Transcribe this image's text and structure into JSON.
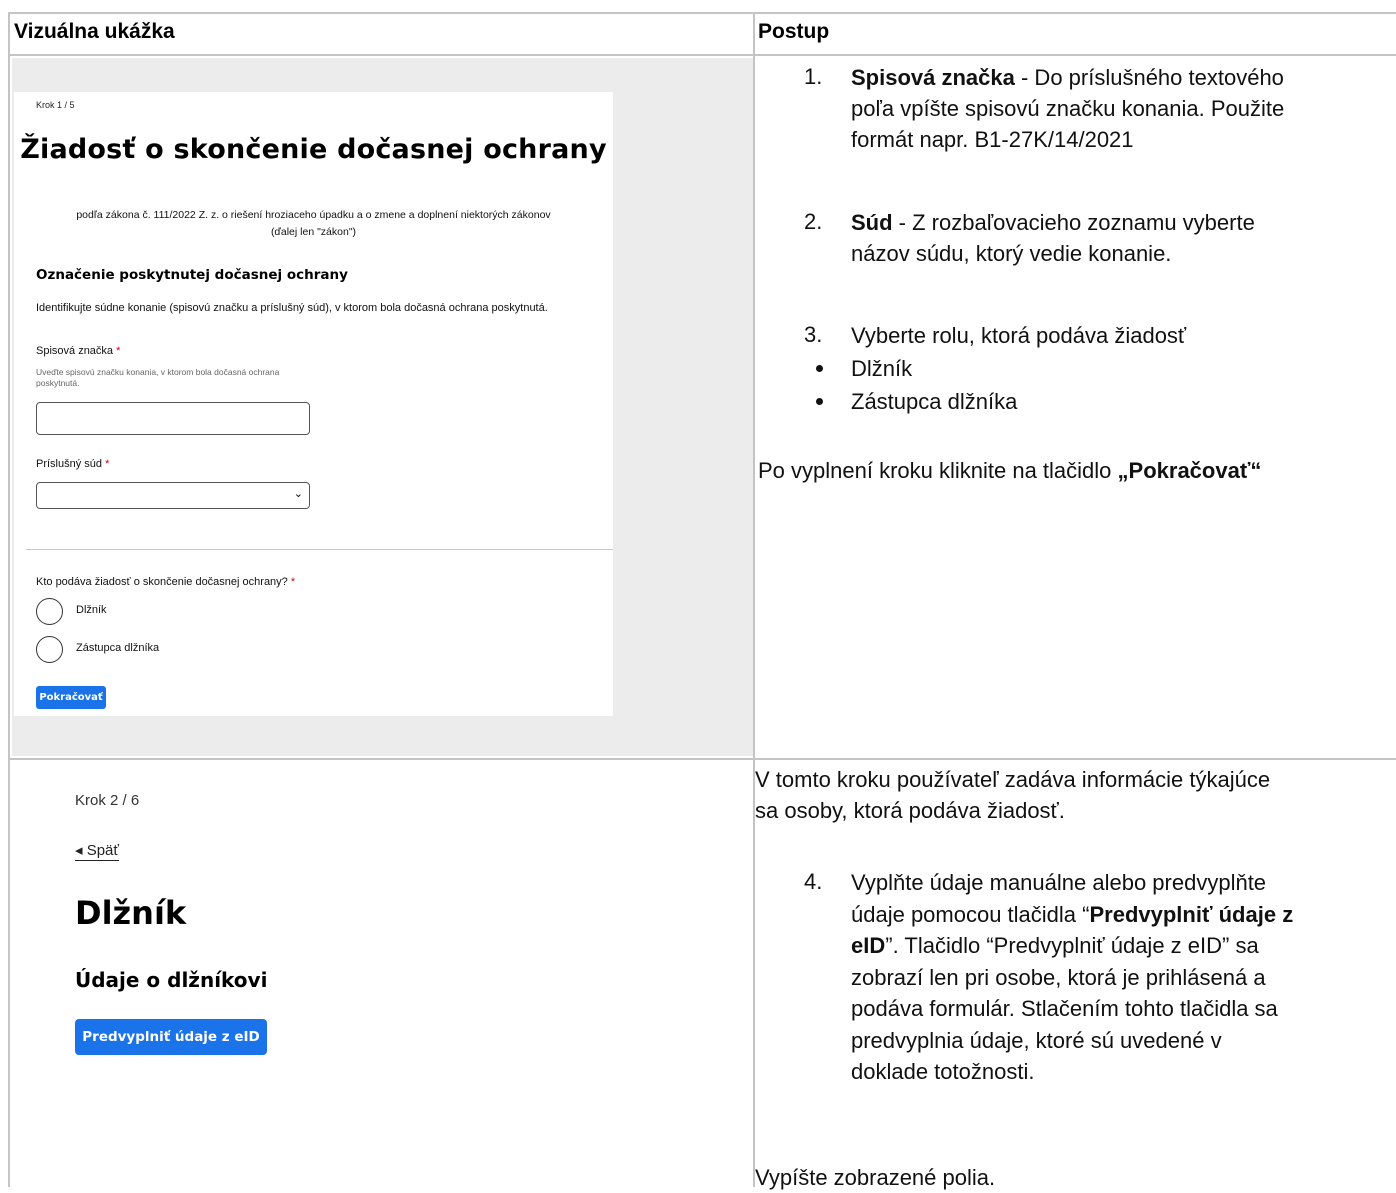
{
  "table": {
    "col1_header": "Vizuálna ukážka",
    "col2_header": "Postup"
  },
  "shot1": {
    "step": "Krok 1 / 5",
    "title": "Žiadosť o skončenie dočasnej ochrany",
    "subtitle_line1": "podľa zákona č. 111/2022 Z. z. o riešení hroziaceho úpadku a o zmene a doplnení niektorých zákonov",
    "subtitle_line2": "(ďalej len \"zákon\")",
    "section_title": "Označenie poskytnutej dočasnej ochrany",
    "intro": "Identifikujte súdne konanie (spisovú značku a príslušný súd), v ktorom bola dočasná ochrana poskytnutá.",
    "case_label": "Spisová značka",
    "required_mark": "*",
    "case_hint": "Uveďte spisovú značku konania, v ktorom bola dočasná ochrana poskytnutá.",
    "case_value": "",
    "court_label": "Príslušný súd",
    "court_value": "",
    "who_label": "Kto podáva žiadosť o skončenie dočasnej ochrany?",
    "radio_debtor": "Dlžník",
    "radio_representative": "Zástupca dlžníka",
    "continue_button": "Pokračovať"
  },
  "instructions1": {
    "item1_num": "1.",
    "item1_bold": "Spisová značka",
    "item1_text_a": " - Do príslušného textového",
    "item1_text_b": "poľa vpíšte spisovú značku konania. Použite",
    "item1_text_c": "formát napr. B1-27K/14/2021",
    "item2_num": "2.",
    "item2_bold": "Súd",
    "item2_text_a": " - Z rozbaľovacieho zoznamu vyberte",
    "item2_text_b": "názov súdu, ktorý vedie konanie.",
    "item3_num": "3.",
    "item3_text": "Vyberte rolu, ktorá podáva žiadosť",
    "bullet1": "Dlžník",
    "bullet2": "Zástupca dlžníka",
    "footer_text": "Po vyplnení kroku kliknite na tlačidlo ",
    "footer_bold": "„Pokračovať“"
  },
  "shot2": {
    "step": "Krok 2 / 6",
    "back_link": "◂ Späť",
    "heading": "Dlžník",
    "subheading": "Údaje o dlžníkovi",
    "prefill_button": "Predvyplniť údaje z eID"
  },
  "instructions2": {
    "intro_line1": "V tomto kroku používateľ zadáva informácie týkajúce",
    "intro_line2": "sa osoby, ktorá podáva žiadosť.",
    "item4_num": "4.",
    "item4_line1": "Vyplňte údaje manuálne alebo predvyplňte",
    "item4_line2_a": "údaje pomocou tlačidla “",
    "item4_line2_bold": "Predvyplniť údaje z",
    "item4_line3_bold": "eID",
    "item4_line3_b": "”. Tlačidlo “Predvyplniť údaje z eID” sa",
    "item4_line4": "zobrazí len pri osobe, ktorá je prihlásená a",
    "item4_line5": "podáva formulár. Stlačením tohto tlačidla sa",
    "item4_line6": "predvyplnia údaje, ktoré sú uvedené v",
    "item4_line7": "doklade totožnosti.",
    "fill_fields": "Vypíšte zobrazené polia."
  }
}
